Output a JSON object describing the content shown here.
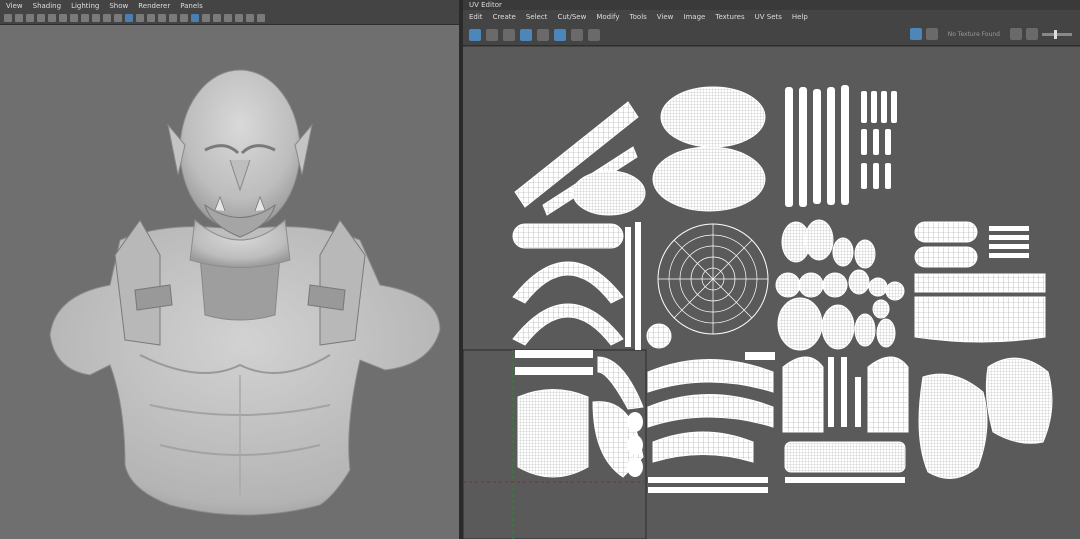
{
  "viewport": {
    "menus": [
      "View",
      "Shading",
      "Lighting",
      "Show",
      "Renderer",
      "Panels"
    ]
  },
  "uv_editor": {
    "title": "UV Editor",
    "menus": [
      "Edit",
      "Create",
      "Select",
      "Cut/Sew",
      "Modify",
      "Tools",
      "View",
      "Image",
      "Textures",
      "UV Sets",
      "Help"
    ],
    "texture_label": "No Texture Found"
  },
  "colors": {
    "accent": "#4a7fb0",
    "viewport_bg": "#6f6f6f",
    "uv_bg": "#5a5a5a"
  }
}
